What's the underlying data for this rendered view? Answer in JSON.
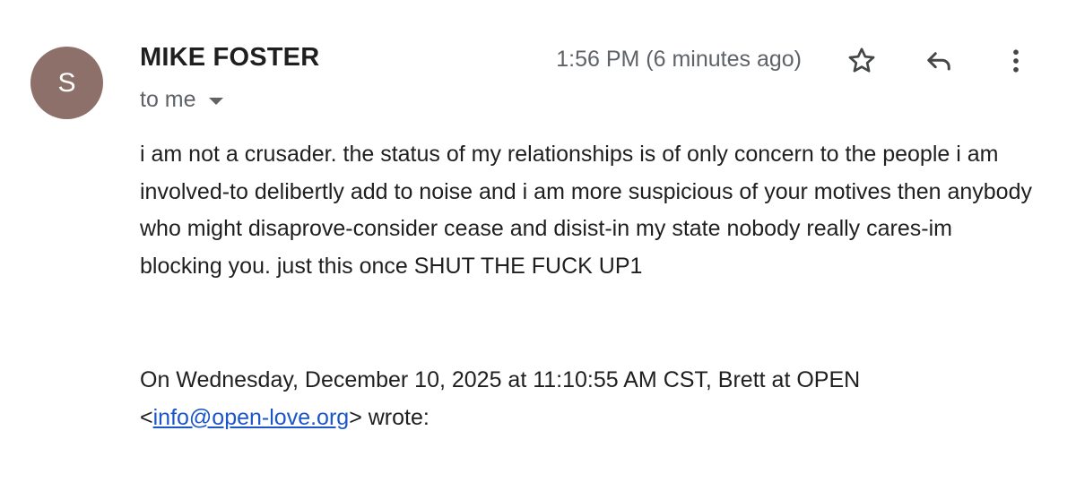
{
  "sender": {
    "avatar_letter": "S",
    "avatar_color": "#8d7069",
    "name": "MIKE FOSTER"
  },
  "recipient": {
    "label": "to me"
  },
  "timestamp": "1:56 PM (6 minutes ago)",
  "actions": {
    "star_icon": "star-icon",
    "reply_icon": "reply-icon",
    "more_icon": "more-vert-icon"
  },
  "message": {
    "body": "i am not a crusader. the status of my relationships is of only concern to the people i am involved-to delibertly add to noise and i am more suspicious of your motives then anybody who might disaprove-consider cease and disist-in my state nobody really cares-im blocking you. just this once SHUT THE FUCK UP1",
    "quote_intro": "On Wednesday, December 10, 2025 at 11:10:55 AM CST, Brett at OPEN",
    "quote_lt": "<",
    "quote_email": "info@open-love.org",
    "quote_suffix": "> wrote:"
  },
  "colors": {
    "link": "#1a56c9",
    "secondary_text": "#5f6368",
    "primary_text": "#1f1f1f"
  }
}
